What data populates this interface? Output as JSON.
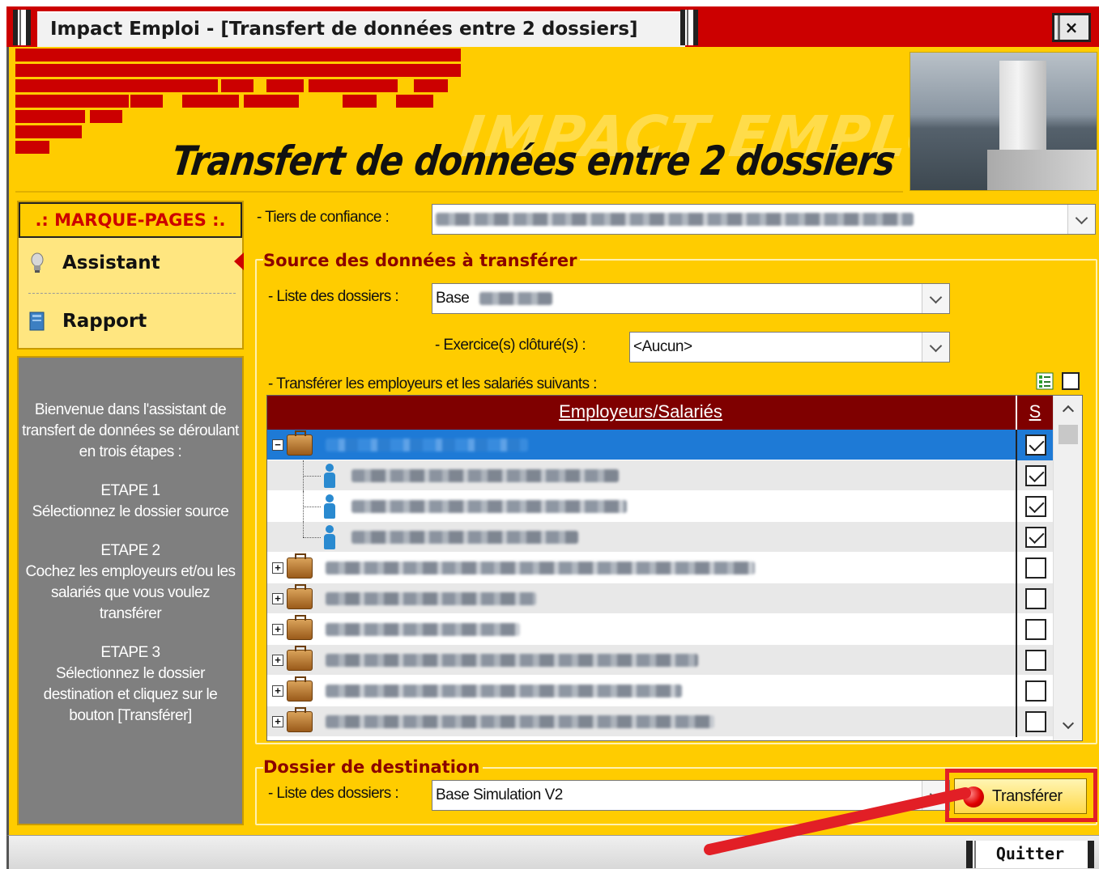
{
  "window": {
    "title": "Impact Emploi - [Transfert de données entre 2 dossiers]",
    "close_label": "×"
  },
  "banner": {
    "watermark": "IMPACT EMPLOI",
    "title": "Transfert de données entre 2 dossiers"
  },
  "sidebar": {
    "header": ".: MARQUE-PAGES :.",
    "items": [
      {
        "label": "Assistant",
        "icon": "lightbulb-icon",
        "selected": true
      },
      {
        "label": "Rapport",
        "icon": "book-icon",
        "selected": false
      }
    ],
    "help": [
      "Bienvenue dans l'assistant de transfert de données se déroulant en trois étapes :",
      "ETAPE 1\nSélectionnez le dossier source",
      "ETAPE 2\nCochez les employeurs et/ou les salariés que vous voulez transférer",
      "ETAPE 3\nSélectionnez le dossier destination et cliquez sur le bouton [Transférer]"
    ]
  },
  "form": {
    "tiers_label": "- Tiers de confiance :",
    "source": {
      "title": "Source des données à transférer",
      "liste_label": "- Liste des dossiers :",
      "liste_value": "Base",
      "exercice_label": "- Exercice(s) clôturé(s) :",
      "exercice_value": "<Aucun>",
      "transfer_label": "- Transférer les employeurs et les salariés suivants :"
    },
    "grid": {
      "col_main": "Employeurs/Salariés",
      "col_s": "S",
      "rows": [
        {
          "type": "employer",
          "expanded": true,
          "checked": true,
          "selected": true
        },
        {
          "type": "employee",
          "checked": true
        },
        {
          "type": "employee",
          "checked": true
        },
        {
          "type": "employee",
          "checked": true
        },
        {
          "type": "employer",
          "expanded": false,
          "checked": false
        },
        {
          "type": "employer",
          "expanded": false,
          "checked": false
        },
        {
          "type": "employer",
          "expanded": false,
          "checked": false
        },
        {
          "type": "employer",
          "expanded": false,
          "checked": false
        },
        {
          "type": "employer",
          "expanded": false,
          "checked": false
        },
        {
          "type": "employer",
          "expanded": false,
          "checked": false
        }
      ]
    },
    "destination": {
      "title": "Dossier de destination",
      "liste_label": "- Liste des dossiers :",
      "liste_value": "Base Simulation V2"
    },
    "transfer_button": "Transférer"
  },
  "statusbar": {
    "quit_button": "Quitter"
  },
  "colors": {
    "accent": "#cc0000",
    "background": "#ffcc00",
    "grid_header": "#7f0000",
    "selection": "#1e7ad6",
    "annotation": "#e21f26"
  }
}
